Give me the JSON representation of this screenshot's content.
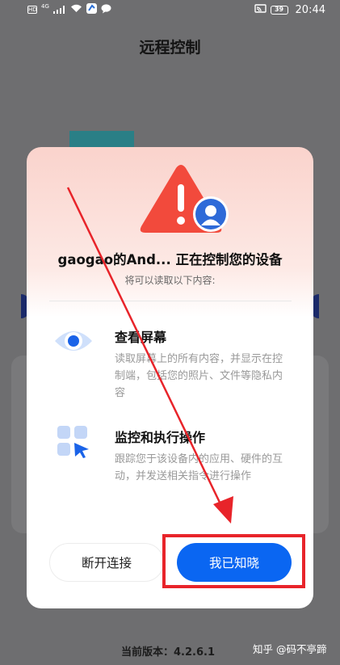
{
  "status_bar": {
    "left_box": "HD",
    "network": "4G",
    "battery": "39",
    "time": "20:44",
    "icons": [
      "hd-icon",
      "signal-icon",
      "wifi-icon",
      "app-notification-icon",
      "chat-icon",
      "cast-icon",
      "battery-icon"
    ]
  },
  "app": {
    "title": "远程控制",
    "version": "当前版本：4.2.6.1"
  },
  "dialog": {
    "title": "gaogao的And... 正在控制您的设备",
    "subtitle": "将可以读取以下内容:",
    "permissions": [
      {
        "title": "查看屏幕",
        "description": "读取屏幕上的所有内容，并显示在控制端，包括您的照片、文件等隐私内容",
        "icon": "eye-icon"
      },
      {
        "title": "监控和执行操作",
        "description": "跟踪您于该设备内的应用、硬件的互动，并发送相关指令进行操作",
        "icon": "grid-pointer-icon"
      }
    ],
    "buttons": {
      "disconnect": "断开连接",
      "acknowledge": "我已知晓"
    }
  },
  "watermark": "知乎 @码不亭蹄",
  "colors": {
    "warning_red": "#f24a3c",
    "primary_blue": "#0a66f2",
    "annotation_red": "#e8242a"
  }
}
